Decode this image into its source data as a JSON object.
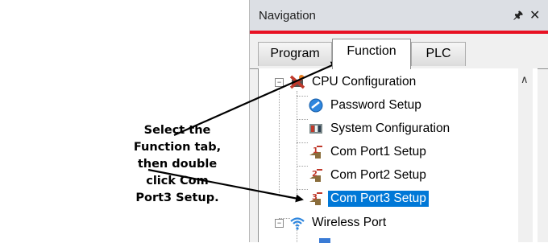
{
  "callout": {
    "line1": "Select the Function tab,",
    "line2": "then double click Com",
    "line3": "Port3 Setup."
  },
  "panel": {
    "title": "Navigation",
    "pin_icon": "pin-icon",
    "close_icon": "close-icon",
    "accent_color": "#e81123",
    "tabs": [
      {
        "label": "Program",
        "active": false
      },
      {
        "label": "Function",
        "active": true
      },
      {
        "label": "PLC",
        "active": false
      }
    ]
  },
  "tree": {
    "root": {
      "label": "CPU Configuration",
      "icon": "cpu-config-icon",
      "expander": "−"
    },
    "items": [
      {
        "label": "Password Setup",
        "icon": "password-icon"
      },
      {
        "label": "System Configuration",
        "icon": "system-config-icon"
      },
      {
        "label": "Com Port1 Setup",
        "icon": "com-port-icon"
      },
      {
        "label": "Com Port2 Setup",
        "icon": "com-port-icon"
      },
      {
        "label": "Com Port3 Setup",
        "icon": "com-port-icon",
        "selected": true
      }
    ],
    "wireless": {
      "label": "Wireless Port",
      "icon": "wifi-icon",
      "expander": "−"
    }
  },
  "selection_color": "#0078d7"
}
